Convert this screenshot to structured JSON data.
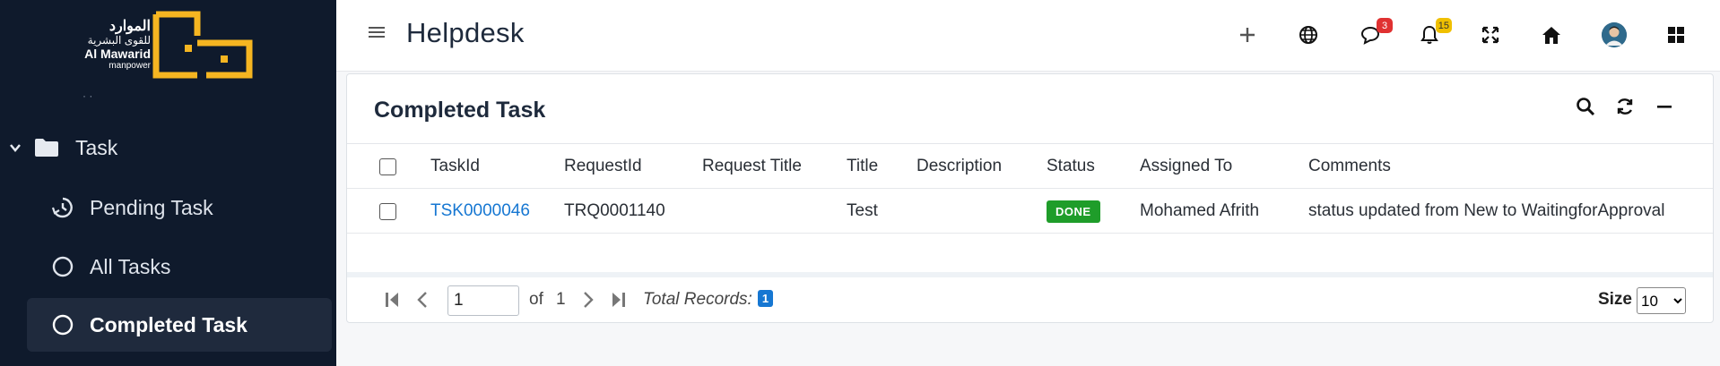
{
  "brand": {
    "arabic_line1": "الموارد",
    "arabic_line2": "للقوى البشرية",
    "english_line1": "Al Mawarid",
    "english_line2": "manpower",
    "accent_color": "#f5b521"
  },
  "sidebar": {
    "group": {
      "label": "Task",
      "expanded": true
    },
    "items": [
      {
        "label": "Pending Task",
        "icon": "clock-cycle-icon",
        "active": false
      },
      {
        "label": "All Tasks",
        "icon": "circle-icon",
        "active": false
      },
      {
        "label": "Completed Task",
        "icon": "circle-icon",
        "active": true
      }
    ]
  },
  "topbar": {
    "title": "Helpdesk",
    "messages_count": "3",
    "notifications_count": "15"
  },
  "card": {
    "title": "Completed Task",
    "columns": [
      "TaskId",
      "RequestId",
      "Request Title",
      "Title",
      "Description",
      "Status",
      "Assigned To",
      "Comments"
    ],
    "rows": [
      {
        "task_id": "TSK0000046",
        "request_id": "TRQ0001140",
        "request_title": "",
        "title": "Test",
        "description": "",
        "status": "DONE",
        "assigned_to": "Mohamed Afrith",
        "comments": "status updated from New to WaitingforApproval"
      }
    ]
  },
  "pager": {
    "page_value": "1",
    "of_label": "of",
    "total_pages": "1",
    "total_records_label": "Total Records:",
    "total_records": "1",
    "size_label": "Size",
    "size_value": "10"
  }
}
